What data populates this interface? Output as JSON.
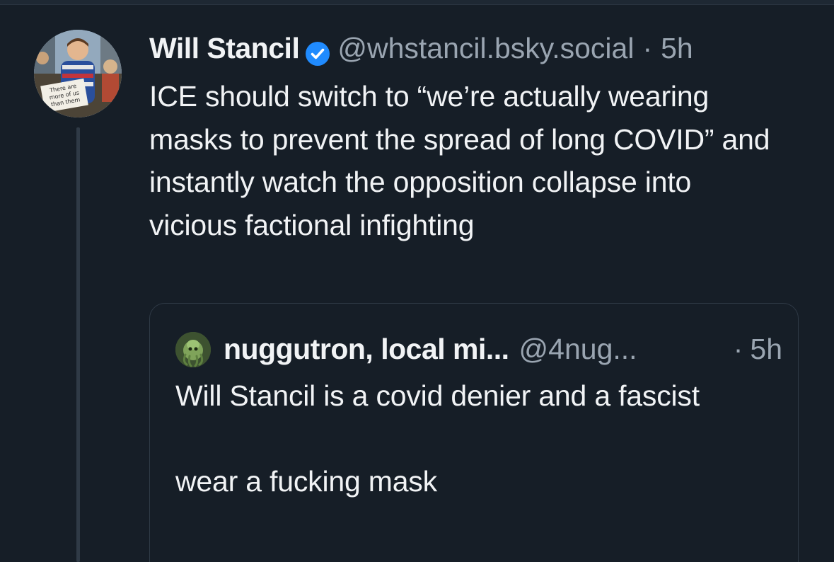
{
  "post": {
    "author_name": "Will Stancil",
    "handle": "@whstancil.bsky.social",
    "separator": "·",
    "time": "5h",
    "verified": true,
    "avatar_sign_text": "There are more of us than them",
    "text": "ICE should switch to “we’re actually wearing masks to prevent the spread of long COVID” and instantly watch the opposition collapse into vicious factional infighting"
  },
  "quote": {
    "author_name": "nuggutron, local mi...",
    "handle": "@4nug...",
    "separator": "·",
    "time": "5h",
    "text": "Will Stancil is a covid denier and a fascist\n\nwear a fucking mask"
  },
  "colors": {
    "background": "#161e27",
    "text_primary": "#f1f3f5",
    "text_secondary": "#9aa5b1",
    "verified_badge": "#208bfe",
    "border": "#2f3a46"
  },
  "icons": {
    "verified": "verified-check-icon"
  }
}
